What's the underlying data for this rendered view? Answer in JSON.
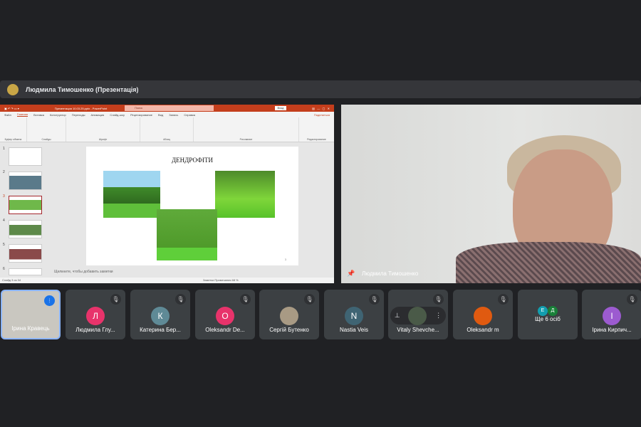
{
  "header": {
    "title": "Людмила Тимошенко (Презентація)"
  },
  "powerpoint": {
    "title": "Презентация 10.03.25.pptx - PowerPoint",
    "search": "Поиск",
    "signin": "Вход",
    "tabs": [
      "Файл",
      "Главная",
      "Вставка",
      "Конструктор",
      "Переходы",
      "Анимация",
      "Слайд-шоу",
      "Рецензирование",
      "Вид",
      "Запись",
      "Справка"
    ],
    "share": "Поделиться",
    "groups": [
      "Буфер обмена",
      "Слайды",
      "Шрифт",
      "Абзац",
      "Рисование",
      "Редактирование"
    ],
    "slide_numbers": [
      "1",
      "2",
      "3",
      "4",
      "5",
      "6"
    ],
    "slide_title": "ДЕНДРОФІТИ",
    "slide_page": "3",
    "notes_placeholder": "Щелкните, чтобы добавить заметки",
    "status": "Слайд 3 из 34",
    "status_right": "Заметки   Примечания      68 %"
  },
  "camera": {
    "name": "Людмила Тимошенко"
  },
  "participants": [
    {
      "name": "Ірина Кравець",
      "self": true
    },
    {
      "name": "Людмила Глу...",
      "initial": "Л",
      "color": "#e8336b"
    },
    {
      "name": "Катерина Бер...",
      "initial": "К",
      "color": "#5f8a96"
    },
    {
      "name": "Oleksandr De...",
      "initial": "O",
      "color": "#e8336b"
    },
    {
      "name": "Сергій Бутенко",
      "photo": true,
      "color": "#a89a84"
    },
    {
      "name": "Nastia Veis",
      "initial": "N",
      "color": "#3f6473"
    },
    {
      "name": "Vitaly Shevche...",
      "photo": true,
      "color": "#4a5a48"
    },
    {
      "name": "Oleksandr m",
      "photo": true,
      "color": "#e05a10"
    },
    {
      "name": "Ще 6 осіб",
      "others": [
        "Е",
        "Д"
      ],
      "colors": [
        "#129eaf",
        "#188038"
      ]
    },
    {
      "name": "Ірина Кирпич...",
      "initial": "І",
      "color": "#9c5bd0"
    }
  ]
}
